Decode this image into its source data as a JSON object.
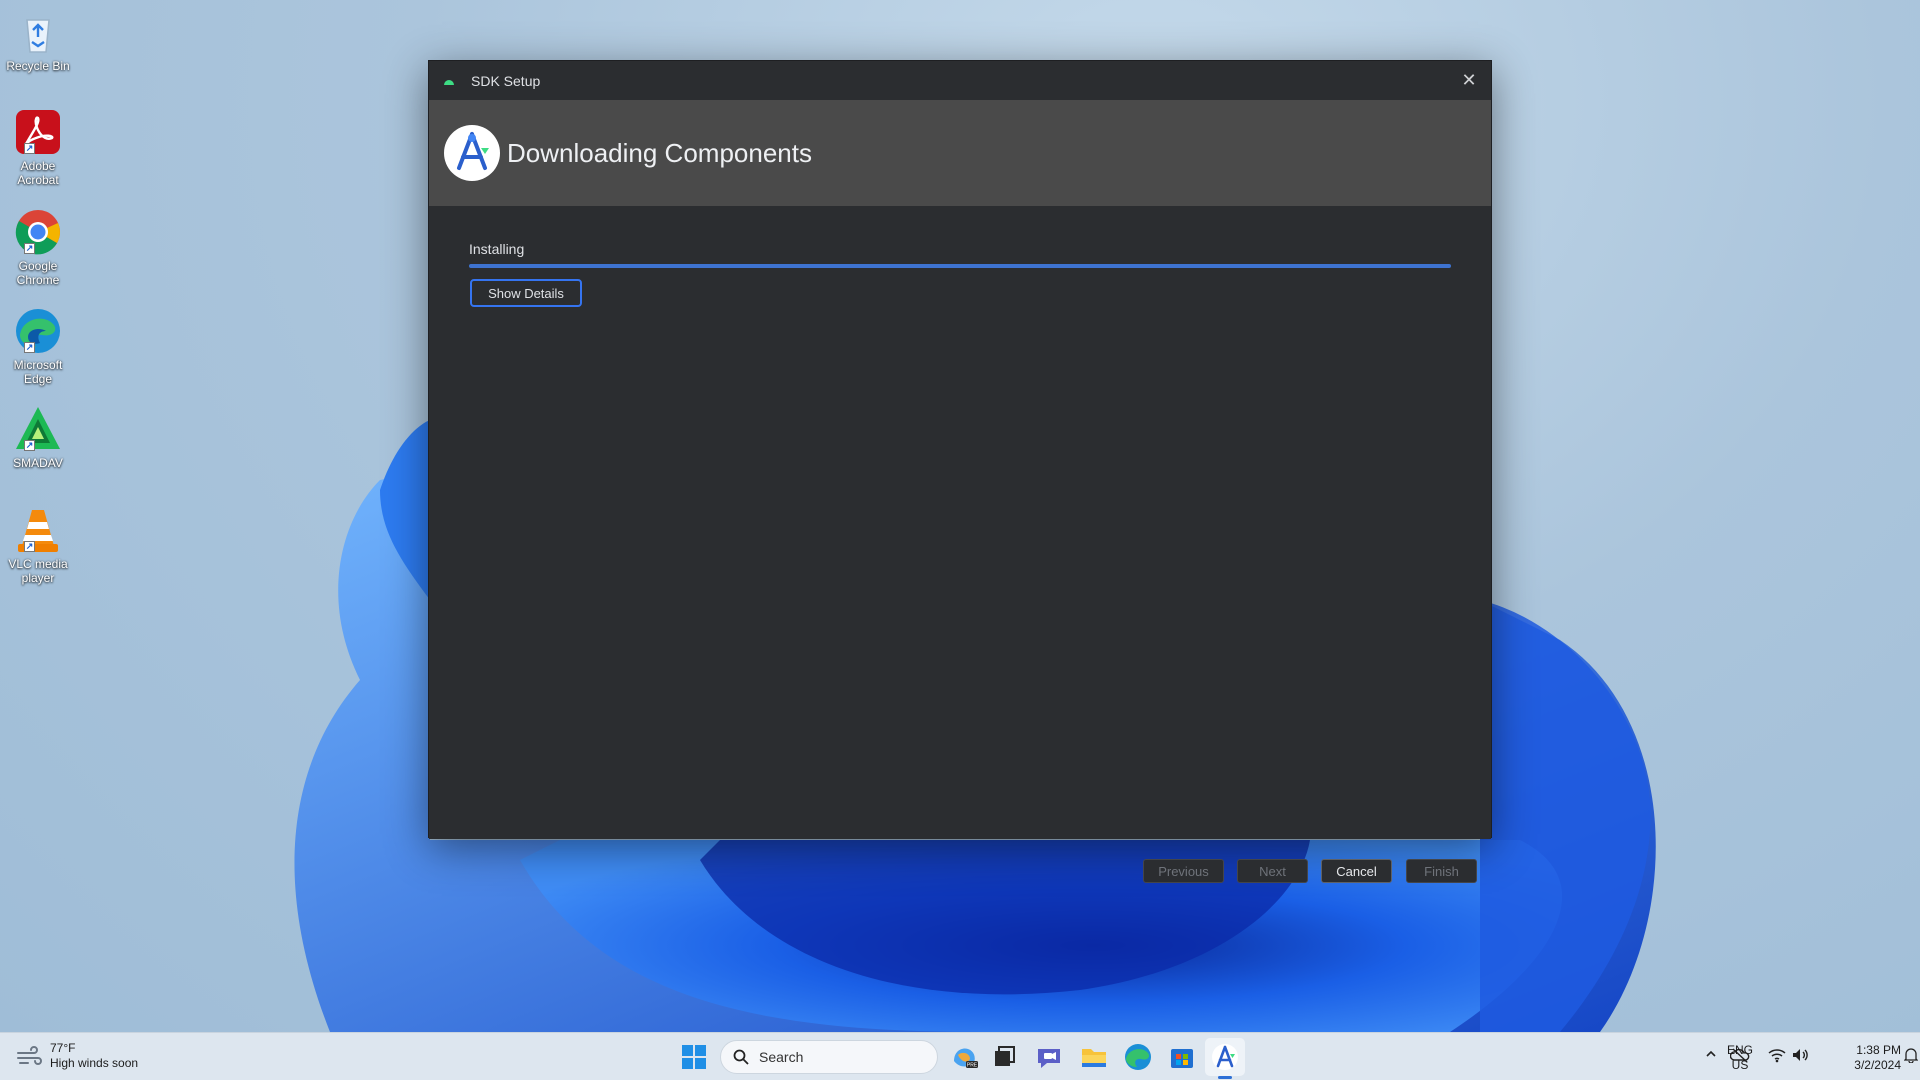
{
  "desktop": {
    "icons": [
      {
        "label": "Recycle Bin",
        "icon": "recycle-bin-icon"
      },
      {
        "label": "Adobe Acrobat",
        "icon": "adobe-acrobat-icon"
      },
      {
        "label": "Google Chrome",
        "icon": "google-chrome-icon"
      },
      {
        "label": "Microsoft Edge",
        "icon": "microsoft-edge-icon"
      },
      {
        "label": "SMADAV",
        "icon": "smadav-icon"
      },
      {
        "label": "VLC media player",
        "icon": "vlc-icon"
      }
    ]
  },
  "dialog": {
    "window_title": "SDK Setup",
    "header_title": "Downloading Components",
    "status_label": "Installing",
    "progress_fraction": 1.0,
    "show_details_label": "Show Details",
    "buttons": {
      "previous": "Previous",
      "next": "Next",
      "cancel": "Cancel",
      "finish": "Finish"
    },
    "colors": {
      "accent": "#3574f0",
      "background": "#2b2d30",
      "header": "#4a4a4a"
    }
  },
  "taskbar": {
    "weather": {
      "temp": "77°F",
      "condition": "High winds soon"
    },
    "search_placeholder": "Search",
    "apps": [
      "copilot-icon",
      "task-view-icon",
      "teams-chat-icon",
      "file-explorer-icon",
      "edge-icon",
      "microsoft-store-icon",
      "android-studio-icon"
    ],
    "tray": {
      "lang_line1": "ENG",
      "lang_line2": "US",
      "time": "1:38 PM",
      "date": "3/2/2024"
    }
  }
}
